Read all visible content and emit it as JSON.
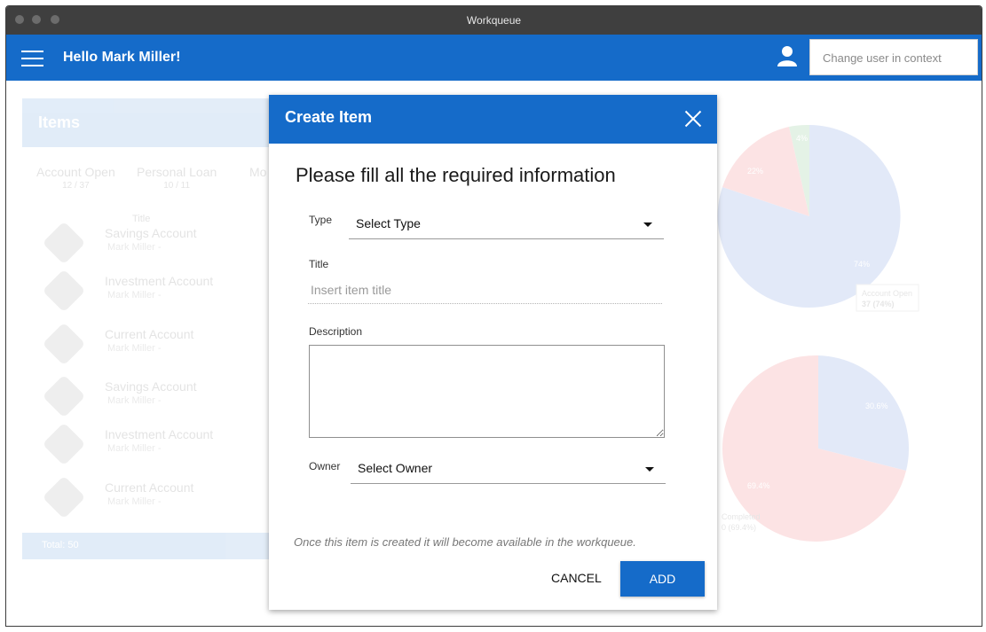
{
  "window": {
    "title": "Workqueue"
  },
  "appbar": {
    "greeting": "Hello Mark Miller!",
    "user_select_placeholder": "Change user in context"
  },
  "background": {
    "items_title": "Items",
    "tabs": [
      {
        "label": "Account Open",
        "count": "12 / 37"
      },
      {
        "label": "Personal Loan",
        "count": "10 / 11"
      },
      {
        "label": "Mo"
      }
    ],
    "column_title": "Title",
    "items": [
      {
        "name": "Savings Account",
        "owner": "Mark Miller -"
      },
      {
        "name": "Investment Account",
        "owner": "Mark Miller -"
      },
      {
        "name": "Current Account",
        "owner": "Mark Miller -"
      },
      {
        "name": "Savings Account",
        "owner": "Mark Miller -"
      },
      {
        "name": "Investment Account",
        "owner": "Mark Miller -"
      },
      {
        "name": "Current Account",
        "owner": "Mark Miller -"
      }
    ],
    "footer": "Total: 50",
    "chart1_tooltip": "Account Open",
    "chart1_tooltip_value": "37 (74%)",
    "chart2_tooltip": "Completed",
    "chart2_tooltip_value": "0 (69.4%)",
    "chart2_label_a": "30.6%",
    "chart2_label_b": "69.4%",
    "chart1_label_a": "22%",
    "chart1_label_b": "74%",
    "chart1_label_c": "4%"
  },
  "modal": {
    "title": "Create Item",
    "heading": "Please fill all the required information",
    "type_label": "Type",
    "type_value": "Select Type",
    "title_label": "Title",
    "title_placeholder": "Insert item title",
    "description_label": "Description",
    "owner_label": "Owner",
    "owner_value": "Select Owner",
    "note": "Once this item is created it will become available in the workqueue.",
    "cancel_label": "CANCEL",
    "add_label": "ADD"
  },
  "colors": {
    "primary": "#156bc9",
    "titlebar": "#3f3f3f"
  },
  "icons": [
    "menu-icon",
    "user-icon",
    "close-icon",
    "chevron-down-icon",
    "tag-icon"
  ]
}
